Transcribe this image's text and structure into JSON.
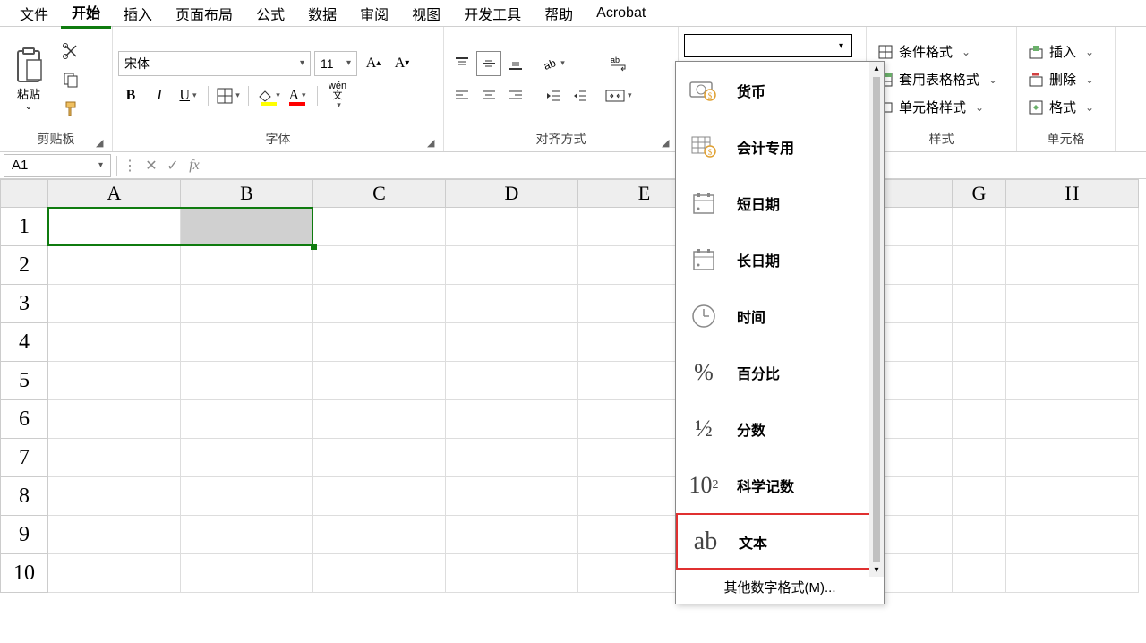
{
  "menu": {
    "items": [
      "文件",
      "开始",
      "插入",
      "页面布局",
      "公式",
      "数据",
      "审阅",
      "视图",
      "开发工具",
      "帮助",
      "Acrobat"
    ],
    "active_index": 1
  },
  "ribbon": {
    "clipboard": {
      "paste": "粘贴",
      "label": "剪贴板"
    },
    "font": {
      "name": "宋体",
      "size": "11",
      "label": "字体",
      "pinyin": "wén"
    },
    "alignment": {
      "label": "对齐方式"
    },
    "number": {
      "combo_value": "",
      "dropdown": {
        "items": [
          {
            "icon": "currency",
            "label": "货币"
          },
          {
            "icon": "accounting",
            "label": "会计专用"
          },
          {
            "icon": "short-date",
            "label": "短日期"
          },
          {
            "icon": "long-date",
            "label": "长日期"
          },
          {
            "icon": "time",
            "label": "时间"
          },
          {
            "icon": "percent",
            "label": "百分比"
          },
          {
            "icon": "fraction",
            "label": "分数"
          },
          {
            "icon": "scientific",
            "label": "科学记数"
          },
          {
            "icon": "text",
            "label": "文本"
          }
        ],
        "highlighted_index": 8,
        "footer": "其他数字格式(M)..."
      }
    },
    "styles": {
      "conditional": "条件格式",
      "table": "套用表格格式",
      "cell": "单元格样式",
      "label": "样式"
    },
    "cells": {
      "insert": "插入",
      "delete": "删除",
      "format": "格式",
      "label": "单元格"
    }
  },
  "formula_bar": {
    "name_box": "A1",
    "formula": ""
  },
  "grid": {
    "columns": [
      "A",
      "B",
      "C",
      "D",
      "E",
      "G",
      "H"
    ],
    "rows": [
      "1",
      "2",
      "3",
      "4",
      "5",
      "6",
      "7",
      "8",
      "9",
      "10"
    ]
  }
}
